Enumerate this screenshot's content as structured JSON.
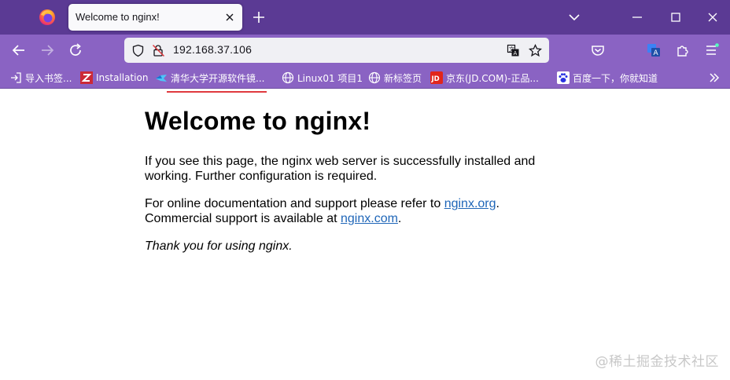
{
  "browser": {
    "tab": {
      "title": "Welcome to nginx!"
    },
    "url": "192.168.37.106",
    "colors": {
      "tabbar": "#5b3a94",
      "toolbar": "#8a63c3",
      "urlbar": "#f0f0f4",
      "url_underline": "#e0393e"
    }
  },
  "bookmarks": [
    {
      "label": "导入书签...",
      "icon": "import-icon"
    },
    {
      "label": "Installation",
      "icon": "zotero-z-icon"
    },
    {
      "label": "清华大学开源软件镜...",
      "icon": "tuna-icon"
    },
    {
      "label": "Linux01 项目1",
      "icon": "globe-icon"
    },
    {
      "label": "新标签页",
      "icon": "globe-icon"
    },
    {
      "label": "京东(JD.COM)-正品...",
      "icon": "jd-icon"
    },
    {
      "label": "百度一下，你就知道",
      "icon": "baidu-paw-icon"
    }
  ],
  "page": {
    "heading": "Welcome to nginx!",
    "p1": "If you see this page, the nginx web server is successfully installed and working. Further configuration is required.",
    "p2_prefix": "For online documentation and support please refer to ",
    "p2_link": "nginx.org",
    "p2_middle": ".",
    "p2_line2_prefix": "Commercial support is available at ",
    "p2_link2": "nginx.com",
    "p2_suffix": ".",
    "p3": "Thank you for using nginx."
  },
  "watermark": "@稀土掘金技术社区"
}
